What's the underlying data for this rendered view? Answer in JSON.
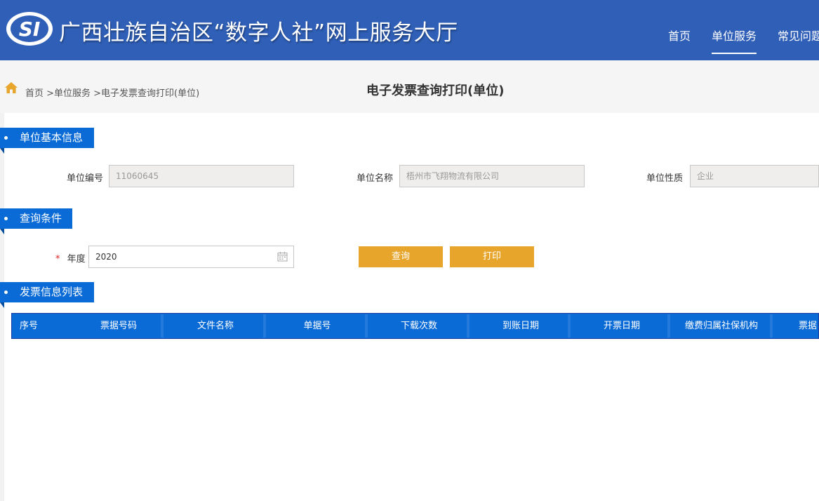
{
  "header": {
    "logo_text": "SI",
    "site_title": "广西壮族自治区“数字人社”网上服务大厅",
    "nav": [
      {
        "label": "首页"
      },
      {
        "label": "单位服务"
      },
      {
        "label": "常见问题"
      }
    ]
  },
  "breadcrumb": {
    "path": "首页 >单位服务 >电子发票查询打印(单位)",
    "page_title": "电子发票查询打印(单位)"
  },
  "sections": {
    "basic_info": "单位基本信息",
    "query": "查询条件",
    "invoice_list": "发票信息列表"
  },
  "basic_info": {
    "unit_no_label": "单位编号",
    "unit_no_value": "11060645",
    "unit_name_label": "单位名称",
    "unit_name_value": "梧州市飞翔物流有限公司",
    "unit_type_label": "单位性质",
    "unit_type_value": "企业"
  },
  "query": {
    "required_mark": "*",
    "year_label": "年度",
    "year_value": "2020",
    "query_button": "查询",
    "print_button": "打印"
  },
  "table": {
    "columns": [
      "序号",
      "票据号码",
      "文件名称",
      "单据号",
      "下载次数",
      "到账日期",
      "开票日期",
      "缴费归属社保机构",
      "票据"
    ]
  },
  "colors": {
    "header_bg": "#2f5fb7",
    "section_blue": "#0a6bd6",
    "button_orange": "#e7a62b"
  }
}
